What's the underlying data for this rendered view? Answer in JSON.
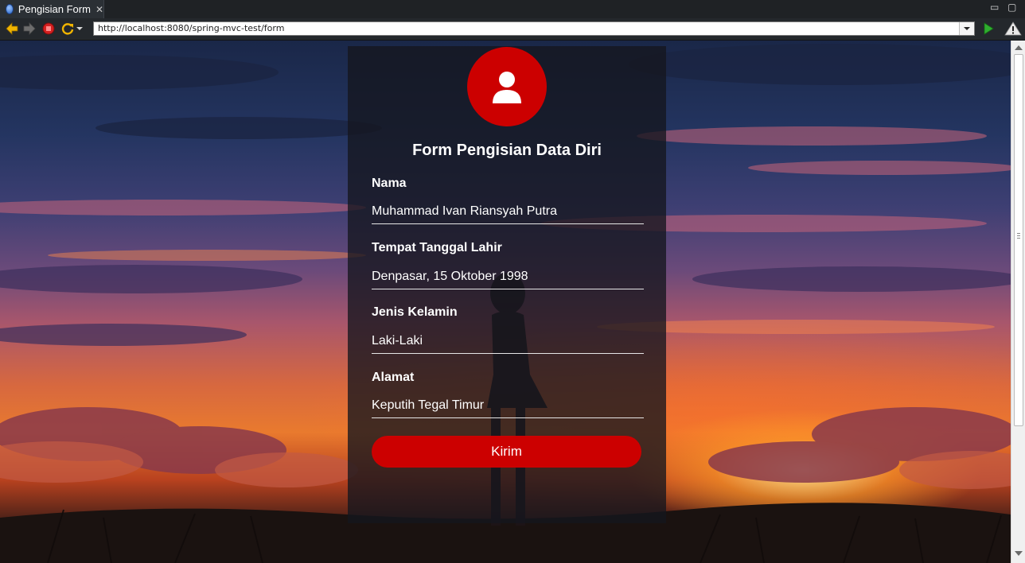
{
  "browser": {
    "tab_title": "Pengisian Form",
    "url": "http://localhost:8080/spring-mvc-test/form"
  },
  "form": {
    "title": "Form Pengisian Data Diri",
    "fields": [
      {
        "label": "Nama",
        "value": "Muhammad Ivan Riansyah Putra"
      },
      {
        "label": "Tempat Tanggal Lahir",
        "value": "Denpasar, 15 Oktober 1998"
      },
      {
        "label": "Jenis Kelamin",
        "value": "Laki-Laki"
      },
      {
        "label": "Alamat",
        "value": "Keputih Tegal Timur"
      }
    ],
    "submit_label": "Kirim"
  },
  "icons": {
    "avatar": "user-icon",
    "back": "arrow-left-icon",
    "forward": "arrow-right-icon",
    "stop": "stop-icon",
    "refresh": "refresh-icon",
    "go": "play-icon",
    "warning": "warning-icon"
  },
  "colors": {
    "accent": "#cc0000",
    "card": "#14161e",
    "text": "#ffffff"
  }
}
